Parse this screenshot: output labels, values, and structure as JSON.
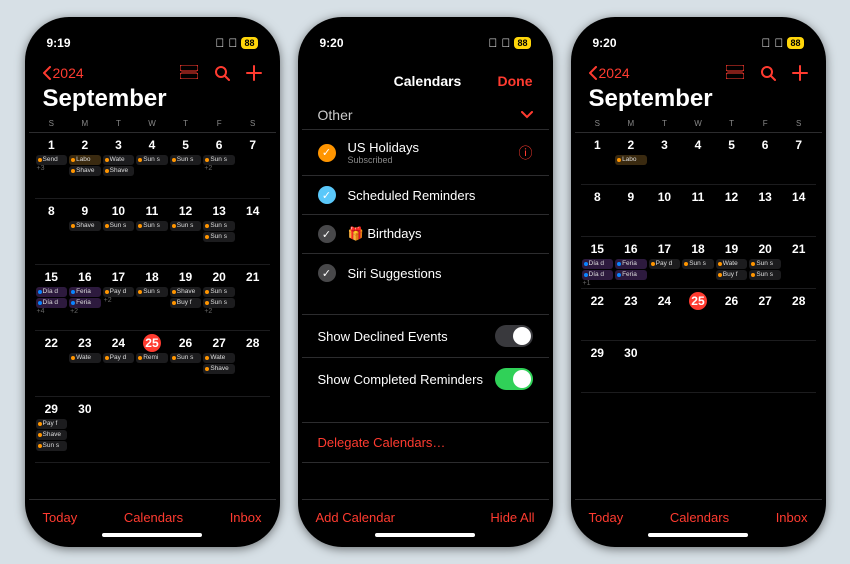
{
  "status": {
    "time_a": "9:19",
    "time_b": "9:20",
    "time_c": "9:20",
    "battery": "88"
  },
  "calendar": {
    "year": "2024",
    "month": "September",
    "weekdays": [
      "S",
      "M",
      "T",
      "W",
      "T",
      "F",
      "S"
    ],
    "todayLabel": "Today",
    "calendarsLabel": "Calendars",
    "inboxLabel": "Inbox"
  },
  "daysFull": [
    [
      {
        "n": "1",
        "pills": [
          [
            "dark",
            "orange",
            "Send"
          ]
        ],
        "more": "+3"
      },
      {
        "n": "2",
        "pills": [
          [
            "orange",
            "orange",
            "Labo"
          ],
          [
            "dark",
            "orange",
            "Shave"
          ]
        ]
      },
      {
        "n": "3",
        "pills": [
          [
            "dark",
            "orange",
            "Wate"
          ],
          [
            "dark",
            "orange",
            "Shave"
          ]
        ]
      },
      {
        "n": "4",
        "pills": [
          [
            "dark",
            "orange",
            "Sun s"
          ]
        ]
      },
      {
        "n": "5",
        "pills": [
          [
            "dark",
            "orange",
            "Sun s"
          ]
        ]
      },
      {
        "n": "6",
        "pills": [
          [
            "dark",
            "orange",
            "Sun s"
          ]
        ],
        "more": "+2"
      },
      {
        "n": "7",
        "pills": []
      }
    ],
    [
      {
        "n": "8",
        "pills": []
      },
      {
        "n": "9",
        "pills": [
          [
            "dark",
            "orange",
            "Shave"
          ]
        ]
      },
      {
        "n": "10",
        "pills": [
          [
            "dark",
            "orange",
            "Sun s"
          ]
        ]
      },
      {
        "n": "11",
        "pills": [
          [
            "dark",
            "orange",
            "Sun s"
          ]
        ]
      },
      {
        "n": "12",
        "pills": [
          [
            "dark",
            "orange",
            "Sun s"
          ]
        ]
      },
      {
        "n": "13",
        "pills": [
          [
            "dark",
            "orange",
            "Sun s"
          ],
          [
            "dark",
            "orange",
            "Sun s"
          ]
        ]
      },
      {
        "n": "14",
        "pills": []
      }
    ],
    [
      {
        "n": "15",
        "pills": [
          [
            "purple",
            "blue",
            "Día d"
          ],
          [
            "purple",
            "blue",
            "Día d"
          ]
        ],
        "more": "+4"
      },
      {
        "n": "16",
        "pills": [
          [
            "purple",
            "blue",
            "Feria"
          ],
          [
            "purple",
            "blue",
            "Feria"
          ]
        ],
        "more": "+2"
      },
      {
        "n": "17",
        "pills": [
          [
            "dark",
            "orange",
            "Pay d"
          ]
        ],
        "more": "+2"
      },
      {
        "n": "18",
        "pills": [
          [
            "dark",
            "orange",
            "Sun s"
          ]
        ]
      },
      {
        "n": "19",
        "pills": [
          [
            "dark",
            "orange",
            "Shave"
          ],
          [
            "dark",
            "orange",
            "Buy f"
          ]
        ]
      },
      {
        "n": "20",
        "pills": [
          [
            "dark",
            "orange",
            "Sun s"
          ],
          [
            "dark",
            "orange",
            "Sun s"
          ]
        ],
        "more": "+2"
      },
      {
        "n": "21",
        "pills": []
      }
    ],
    [
      {
        "n": "22",
        "pills": []
      },
      {
        "n": "23",
        "pills": [
          [
            "dark",
            "orange",
            "Wate"
          ]
        ]
      },
      {
        "n": "24",
        "pills": [
          [
            "dark",
            "orange",
            "Pay d"
          ]
        ]
      },
      {
        "n": "25",
        "today": true,
        "pills": [
          [
            "dark",
            "orange",
            "Remi"
          ]
        ]
      },
      {
        "n": "26",
        "pills": [
          [
            "dark",
            "orange",
            "Sun s"
          ]
        ]
      },
      {
        "n": "27",
        "pills": [
          [
            "dark",
            "orange",
            "Wate"
          ],
          [
            "dark",
            "orange",
            "Shave"
          ]
        ]
      },
      {
        "n": "28",
        "pills": []
      }
    ],
    [
      {
        "n": "29",
        "pills": [
          [
            "dark",
            "orange",
            "Pay f"
          ],
          [
            "dark",
            "orange",
            "Shave"
          ],
          [
            "dark",
            "orange",
            "Sun s"
          ]
        ]
      },
      {
        "n": "30",
        "pills": []
      },
      {
        "n": "",
        "dim": true
      },
      {
        "n": "",
        "dim": true
      },
      {
        "n": "",
        "dim": true
      },
      {
        "n": "",
        "dim": true
      },
      {
        "n": "",
        "dim": true
      }
    ]
  ],
  "daysLight": [
    [
      {
        "n": "1"
      },
      {
        "n": "2",
        "pills": [
          [
            "orange",
            "orange",
            "Labo"
          ]
        ]
      },
      {
        "n": "3"
      },
      {
        "n": "4"
      },
      {
        "n": "5"
      },
      {
        "n": "6"
      },
      {
        "n": "7"
      }
    ],
    [
      {
        "n": "8"
      },
      {
        "n": "9"
      },
      {
        "n": "10"
      },
      {
        "n": "11"
      },
      {
        "n": "12"
      },
      {
        "n": "13"
      },
      {
        "n": "14"
      }
    ],
    [
      {
        "n": "15",
        "pills": [
          [
            "purple",
            "blue",
            "Día d"
          ],
          [
            "purple",
            "blue",
            "Día d"
          ]
        ],
        "more": "+1"
      },
      {
        "n": "16",
        "pills": [
          [
            "purple",
            "blue",
            "Feria"
          ],
          [
            "purple",
            "blue",
            "Feria"
          ]
        ]
      },
      {
        "n": "17",
        "pills": [
          [
            "dark",
            "orange",
            "Pay d"
          ]
        ]
      },
      {
        "n": "18",
        "pills": [
          [
            "dark",
            "orange",
            "Sun s"
          ]
        ]
      },
      {
        "n": "19",
        "pills": [
          [
            "dark",
            "orange",
            "Wate"
          ],
          [
            "dark",
            "orange",
            "Buy f"
          ]
        ]
      },
      {
        "n": "20",
        "pills": [
          [
            "dark",
            "orange",
            "Sun s"
          ],
          [
            "dark",
            "orange",
            "Sun s"
          ]
        ]
      },
      {
        "n": "21"
      }
    ],
    [
      {
        "n": "22"
      },
      {
        "n": "23"
      },
      {
        "n": "24"
      },
      {
        "n": "25",
        "today": true
      },
      {
        "n": "26"
      },
      {
        "n": "27"
      },
      {
        "n": "28"
      }
    ],
    [
      {
        "n": "29"
      },
      {
        "n": "30"
      },
      {
        "n": "",
        "dim": true
      },
      {
        "n": "",
        "dim": true
      },
      {
        "n": "",
        "dim": true
      },
      {
        "n": "",
        "dim": true
      },
      {
        "n": "",
        "dim": true
      }
    ]
  ],
  "modal": {
    "title": "Calendars",
    "done": "Done",
    "section": "Other",
    "items": [
      {
        "label": "US Holidays",
        "sub": "Subscribed",
        "check": "orange",
        "info": true
      },
      {
        "label": "Scheduled Reminders",
        "check": "teal"
      },
      {
        "label": "Birthdays",
        "check": "gray",
        "icon": "gift"
      },
      {
        "label": "Siri Suggestions",
        "check": "gray"
      }
    ],
    "showDeclined": "Show Declined Events",
    "showCompleted": "Show Completed Reminders",
    "delegate": "Delegate Calendars…",
    "addCalendar": "Add Calendar",
    "hideAll": "Hide All"
  }
}
